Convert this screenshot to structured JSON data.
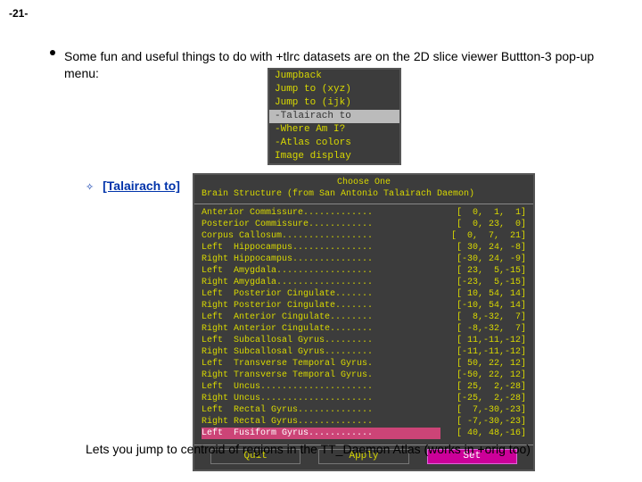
{
  "page_number": "-21-",
  "bullet": "Some fun and useful things to do with +tlrc datasets are on the 2D slice viewer Buttton-3 pop-up menu:",
  "popup_menu": {
    "items": [
      {
        "label": "Jumpback",
        "hl": false
      },
      {
        "label": "Jump to (xyz)",
        "hl": false
      },
      {
        "label": "Jump to (ijk)",
        "hl": false
      },
      {
        "label": "-Talairach to",
        "hl": true
      },
      {
        "label": "-Where Am I?",
        "hl": false
      },
      {
        "label": "-Atlas colors",
        "hl": false
      },
      {
        "label": "Image display",
        "hl": false
      }
    ]
  },
  "sub_label": "[Talairach to]",
  "chooser": {
    "title1": "Choose One",
    "title2": "Brain Structure (from San Antonio Talairach Daemon)",
    "rows": [
      {
        "name": "Anterior Commissure.............",
        "coord": "[  0,  1,  1]",
        "hl": false
      },
      {
        "name": "Posterior Commissure............",
        "coord": "[  0, 23,  0]",
        "hl": false
      },
      {
        "name": "Corpus Callosum.................",
        "coord": "[  0,  7,  21]",
        "hl": false
      },
      {
        "name": "Left  Hippocampus...............",
        "coord": "[ 30, 24, -8]",
        "hl": false
      },
      {
        "name": "Right Hippocampus...............",
        "coord": "[-30, 24, -9]",
        "hl": false
      },
      {
        "name": "Left  Amygdala..................",
        "coord": "[ 23,  5,-15]",
        "hl": false
      },
      {
        "name": "Right Amygdala..................",
        "coord": "[-23,  5,-15]",
        "hl": false
      },
      {
        "name": "Left  Posterior Cingulate.......",
        "coord": "[ 10, 54, 14]",
        "hl": false
      },
      {
        "name": "Right Posterior Cingulate.......",
        "coord": "[-10, 54, 14]",
        "hl": false
      },
      {
        "name": "Left  Anterior Cingulate........",
        "coord": "[  8,-32,  7]",
        "hl": false
      },
      {
        "name": "Right Anterior Cingulate........",
        "coord": "[ -8,-32,  7]",
        "hl": false
      },
      {
        "name": "Left  Subcallosal Gyrus.........",
        "coord": "[ 11,-11,-12]",
        "hl": false
      },
      {
        "name": "Right Subcallosal Gyrus.........",
        "coord": "[-11,-11,-12]",
        "hl": false
      },
      {
        "name": "Left  Transverse Temporal Gyrus.",
        "coord": "[ 50, 22, 12]",
        "hl": false
      },
      {
        "name": "Right Transverse Temporal Gyrus.",
        "coord": "[-50, 22, 12]",
        "hl": false
      },
      {
        "name": "Left  Uncus.....................",
        "coord": "[ 25,  2,-28]",
        "hl": false
      },
      {
        "name": "Right Uncus.....................",
        "coord": "[-25,  2,-28]",
        "hl": false
      },
      {
        "name": "Left  Rectal Gyrus..............",
        "coord": "[  7,-30,-23]",
        "hl": false
      },
      {
        "name": "Right Rectal Gyrus..............",
        "coord": "[ -7,-30,-23]",
        "hl": false
      },
      {
        "name": "Left  Fusiform Gyrus............",
        "coord": "[ 40, 48,-16]",
        "hl": true
      }
    ],
    "buttons": {
      "quit": "Quit",
      "apply": "Apply",
      "set": "Set"
    }
  },
  "after_text": "Lets you jump to centroid of regions in the TT_Daemon Atlas (works in +orig too)"
}
